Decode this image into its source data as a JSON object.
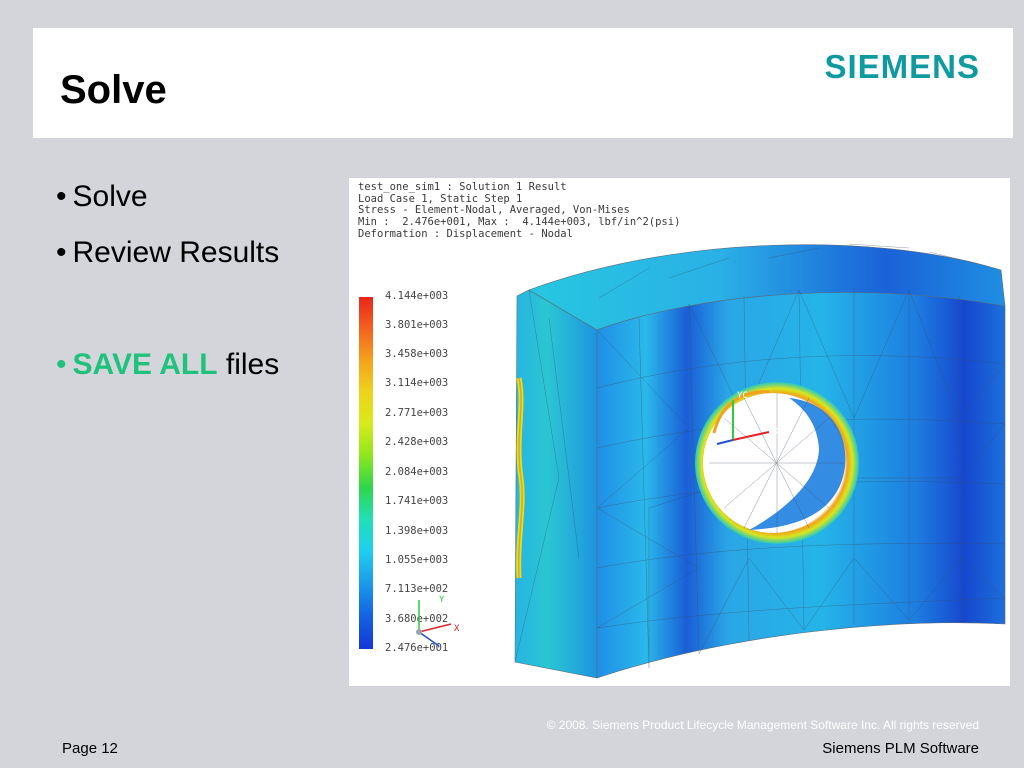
{
  "slide": {
    "title": "Solve",
    "logo_text": "SIEMENS",
    "bullets": [
      {
        "text": "Solve"
      },
      {
        "text": "Review Results"
      },
      {
        "accent": "SAVE ALL",
        "text": " files"
      }
    ],
    "accent_color": "#1fc27d",
    "brand_color": "#0f9aa0"
  },
  "figure": {
    "info_lines": [
      "test_one_sim1 : Solution 1 Result",
      "Load Case 1, Static Step 1",
      "Stress - Element-Nodal, Averaged, Von-Mises",
      "Min :  2.476e+001, Max :  4.144e+003, lbf/in^2(psi)",
      "Deformation : Displacement - Nodal"
    ],
    "legend_ticks": [
      "4.144e+003",
      "3.801e+003",
      "3.458e+003",
      "3.114e+003",
      "2.771e+003",
      "2.428e+003",
      "2.084e+003",
      "1.741e+003",
      "1.398e+003",
      "1.055e+003",
      "7.113e+002",
      "3.680e+002",
      "2.476e+001"
    ],
    "axis_labels": {
      "xc": "XC",
      "yc": "YC",
      "x": "X",
      "y": "Y"
    }
  },
  "footer": {
    "copyright": "© 2008. Siemens Product Lifecycle Management Software Inc. All rights reserved",
    "page": "Page 12",
    "company": "Siemens PLM Software"
  }
}
